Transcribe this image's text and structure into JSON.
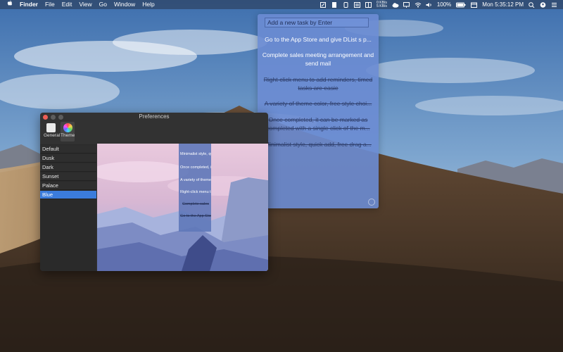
{
  "menubar": {
    "apple": "",
    "app_name": "Finder",
    "menus": [
      "File",
      "Edit",
      "View",
      "Go",
      "Window",
      "Help"
    ],
    "netspeed_up": "0 KB/s",
    "netspeed_down": "5 KB/s",
    "battery": "100%",
    "clock": "Mon 5:35:12 PM"
  },
  "task_window": {
    "input_placeholder": "Add a new task by Enter",
    "tasks": [
      {
        "text": "Go to the App Store and give DList s p...",
        "done": false
      },
      {
        "text": "Complete sales meeting arrangement and send mail",
        "done": false
      },
      {
        "text": "Right-click menu to add reminders, timed tasks are easie",
        "done": true
      },
      {
        "text": "A variety of theme color, free style choi...",
        "done": true
      },
      {
        "text": "Once completed, it can be marked as completed with a single click of the m...",
        "done": true
      },
      {
        "text": "Minimalist style, quick add, free drag a...",
        "done": true
      }
    ]
  },
  "preferences": {
    "title": "Preferences",
    "tabs": [
      {
        "label": "General"
      },
      {
        "label": "Theme"
      }
    ],
    "themes": [
      "Default",
      "Dusk",
      "Dark",
      "Sunset",
      "Palace",
      "Blue"
    ],
    "selected_theme": "Blue",
    "preview_items": [
      {
        "text": "Minimalist style, qui",
        "done": false
      },
      {
        "text": "Once completed, it c",
        "done": false
      },
      {
        "text": "A variety of theme c",
        "done": false
      },
      {
        "text": "Right-click menu to",
        "done": false
      },
      {
        "text": "Complete sales",
        "done": true
      },
      {
        "text": "Go to the App Store",
        "done": true
      }
    ]
  },
  "colors": {
    "task_window_bg": "#6c8cd3",
    "selection": "#3b7cdc",
    "close_button": "#ee5e57"
  }
}
